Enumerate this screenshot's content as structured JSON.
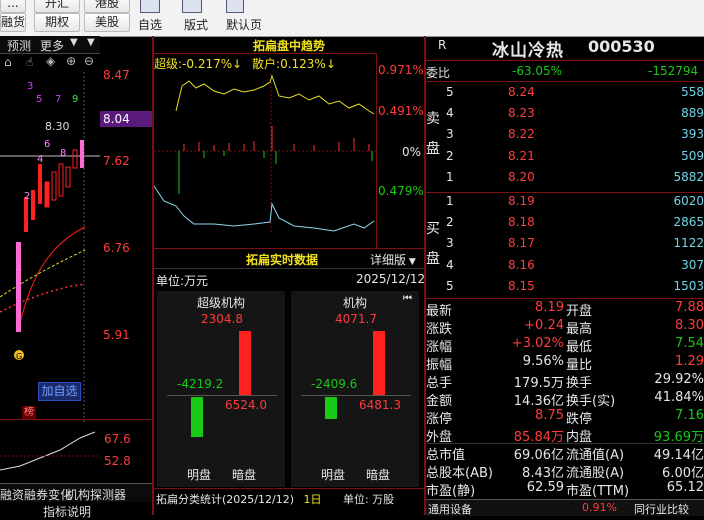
{
  "toolbar": {
    "row1": [
      "...",
      "开汇",
      "港股"
    ],
    "row2": [
      "融货",
      "期权",
      "美股"
    ],
    "labels": [
      "自选",
      "版式",
      "默认页"
    ]
  },
  "kline": {
    "tabs": [
      "预测",
      "更多"
    ],
    "prices": [
      "8.47",
      "8.04",
      "7.62",
      "6.76",
      "5.91"
    ],
    "high_label": "8.30",
    "candle_nums": [
      "3",
      "5",
      "7",
      "9",
      "1",
      "4",
      "6",
      "8",
      "9",
      "2"
    ],
    "add_self": "加自选",
    "ind_values": [
      "67.6",
      "52.8"
    ],
    "bottom_tabs": [
      "融资融券变化",
      "机构探测器"
    ],
    "bottom_sub": "指标说明",
    "rank_badge": "榜"
  },
  "trend": {
    "title": "拓扁盘中趋势",
    "super_label": "超级:",
    "super_value": "-0.217%↓",
    "retail_label": "散户:",
    "retail_value": "0.123%↓",
    "scale": [
      "0.971%",
      "0.491%",
      "0%",
      "0.479%"
    ]
  },
  "realtime": {
    "title": "拓扁实时数据",
    "detail": "详细版",
    "unit": "单位:万元",
    "date": "2025/12/12",
    "panels": [
      {
        "title": "超级机构",
        "buy": "2304.8",
        "sell_label": "-4219.2",
        "net": "6524.0",
        "footer": [
          "明盘",
          "暗盘"
        ]
      },
      {
        "title": "机构",
        "buy": "4071.7",
        "sell_label": "-2409.6",
        "net": "6481.3",
        "footer": [
          "明盘",
          "暗盘"
        ]
      }
    ],
    "class_stat": "拓扁分类统计(2025/12/12)",
    "class_day": "1日",
    "class_unit": "单位: 万股"
  },
  "quote": {
    "tag": "R",
    "name": "冰山冷热",
    "code": "000530",
    "weibi_label": "委比",
    "weibi_pct": "-63.05%",
    "weibi_val": "-152794",
    "sell_side_label": "卖盘",
    "buy_side_label": "买盘",
    "asks": [
      {
        "lvl": "5",
        "price": "8.24",
        "vol": "558"
      },
      {
        "lvl": "4",
        "price": "8.23",
        "vol": "889"
      },
      {
        "lvl": "3",
        "price": "8.22",
        "vol": "393"
      },
      {
        "lvl": "2",
        "price": "8.21",
        "vol": "509"
      },
      {
        "lvl": "1",
        "price": "8.20",
        "vol": "5882"
      }
    ],
    "bids": [
      {
        "lvl": "1",
        "price": "8.19",
        "vol": "6020"
      },
      {
        "lvl": "2",
        "price": "8.18",
        "vol": "2865"
      },
      {
        "lvl": "3",
        "price": "8.17",
        "vol": "1122"
      },
      {
        "lvl": "4",
        "price": "8.16",
        "vol": "307"
      },
      {
        "lvl": "5",
        "price": "8.15",
        "vol": "1503"
      }
    ],
    "stats": [
      [
        "最新",
        "8.19",
        "red",
        "开盘",
        "7.88",
        "red"
      ],
      [
        "涨跌",
        "+0.24",
        "red",
        "最高",
        "8.30",
        "red"
      ],
      [
        "涨幅",
        "+3.02%",
        "red",
        "最低",
        "7.54",
        "green"
      ],
      [
        "振幅",
        "9.56%",
        "white",
        "量比",
        "1.29",
        "red"
      ],
      [
        "总手",
        "179.5万",
        "white",
        "换手",
        "29.92%",
        "white"
      ],
      [
        "金额",
        "14.36亿",
        "white",
        "换手(实)",
        "41.84%",
        "white"
      ],
      [
        "涨停",
        "8.75",
        "red",
        "跌停",
        "7.16",
        "green"
      ],
      [
        "外盘",
        "85.84万",
        "red",
        "内盘",
        "93.69万",
        "green"
      ],
      [
        "总市值",
        "69.06亿",
        "white",
        "流通值(A)",
        "49.14亿",
        "white"
      ],
      [
        "总股本(AB)",
        "8.43亿",
        "white",
        "流通股(A)",
        "6.00亿",
        "white"
      ],
      [
        "市盈(静)",
        "62.59",
        "white",
        "市盈(TTM)",
        "65.12",
        "white"
      ]
    ],
    "footer_left": "通用设备",
    "footer_pct": "0.91%",
    "footer_right": "同行业比较"
  },
  "chart_data": {
    "type": "table",
    "title": "拓扁实时数据",
    "rows": [
      {
        "name": "超级机构",
        "buy": 2304.8,
        "sell": -4219.2,
        "net": 6524.0
      },
      {
        "name": "机构",
        "buy": 4071.7,
        "sell": -2409.6,
        "net": 6481.3
      }
    ]
  }
}
